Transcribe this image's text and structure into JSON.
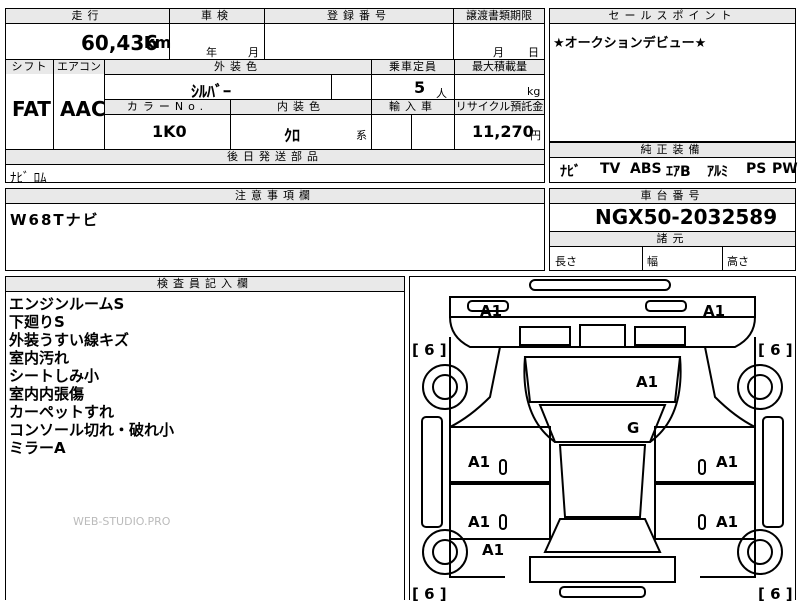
{
  "headers": {
    "mileage": "走行",
    "inspection": "車検",
    "registration": "登録番号",
    "transfer_deadline": "譲渡書類期限",
    "sales_point": "セールスポイント",
    "shift": "シフト",
    "aircon": "エアコン",
    "exterior_color": "外装色",
    "capacity": "乗車定員",
    "max_load": "最大積載量",
    "color_no": "カラーNo.",
    "interior_color": "内装色",
    "import": "輸入車",
    "recycle": "リサイクル預託金",
    "later_parts": "後日発送部品",
    "genuine_equipment": "純正装備",
    "cautions": "注意事項欄",
    "chassis_no": "車台番号",
    "dimensions": "諸元",
    "inspector_notes": "検査員記入欄"
  },
  "values": {
    "mileage": "60,436",
    "mileage_unit": "km",
    "inspection_year": "年",
    "inspection_month": "月",
    "transfer_month": "月",
    "transfer_day": "日",
    "sales_point": "★オークションデビュー★",
    "shift": "FAT",
    "aircon": "AAC",
    "exterior_color": "ｼﾙﾊﾞｰ",
    "capacity": "5",
    "capacity_unit": "人",
    "max_load_unit": "kg",
    "color_no": "1K0",
    "interior_color": "ｸﾛ",
    "interior_suffix": "系",
    "recycle_fee": "11,270",
    "recycle_unit": "円",
    "later_parts": "ﾅﾋﾞ ﾛﾑ",
    "genuine_equipment": [
      "ﾅﾋﾞ",
      "TV",
      "ABS",
      "ｴｱB",
      "ｱﾙﾐ",
      "PS",
      "PW"
    ],
    "cautions": "W68Tナビ",
    "chassis_no": "NGX50-2032589",
    "length_label": "長さ",
    "width_label": "幅",
    "height_label": "高さ"
  },
  "inspector_notes": [
    "エンジンルームS",
    "下廻りS",
    "外装うすい線キズ",
    "室内汚れ",
    "シートしみ小",
    "室内内張傷",
    "カーペットすれ",
    "コンソール切れ・破れ小",
    "ミラーA"
  ],
  "diagram": {
    "marks": [
      "A1",
      "A1",
      "A1",
      "G",
      "A1",
      "A1",
      "A1",
      "A1",
      "A1"
    ],
    "tires": [
      "[ 6 ]",
      "[ 6 ]",
      "[ 6 ]",
      "[ 6 ]"
    ]
  },
  "watermark": "WEB-STUDIO.PRO"
}
